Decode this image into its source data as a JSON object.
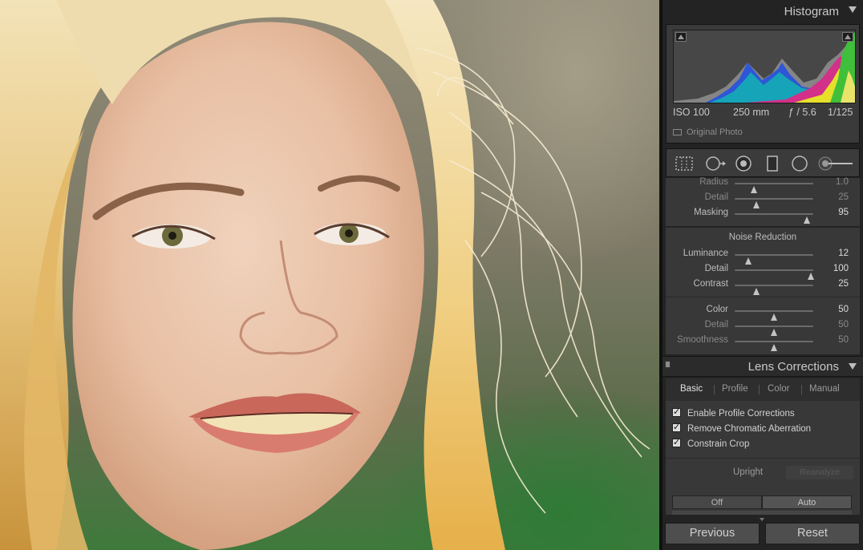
{
  "histogram": {
    "title": "Histogram",
    "iso": "ISO 100",
    "focal": "250 mm",
    "aperture": "ƒ / 5.6",
    "shutter": "1/125",
    "original_photo_label": "Original Photo"
  },
  "detail": {
    "rows": [
      {
        "label": "Radius",
        "value": "1.0",
        "level": 0.24,
        "dim": true
      },
      {
        "label": "Detail",
        "value": "25",
        "level": 0.28,
        "dim": true
      },
      {
        "label": "Masking",
        "value": "95",
        "level": 0.92,
        "dim": false
      }
    ]
  },
  "noise_reduction": {
    "title": "Noise Reduction",
    "luminance_rows": [
      {
        "label": "Luminance",
        "value": "12",
        "level": 0.17,
        "dim": false
      },
      {
        "label": "Detail",
        "value": "100",
        "level": 0.97,
        "dim": false
      },
      {
        "label": "Contrast",
        "value": "25",
        "level": 0.28,
        "dim": false
      }
    ],
    "color_rows": [
      {
        "label": "Color",
        "value": "50",
        "level": 0.5,
        "dim": false
      },
      {
        "label": "Detail",
        "value": "50",
        "level": 0.5,
        "dim": true
      },
      {
        "label": "Smoothness",
        "value": "50",
        "level": 0.5,
        "dim": true
      }
    ]
  },
  "lens_corrections": {
    "title": "Lens Corrections",
    "tabs": [
      "Basic",
      "Profile",
      "Color",
      "Manual"
    ],
    "active_tab": "Basic",
    "checkboxes": [
      "Enable Profile Corrections",
      "Remove Chromatic Aberration",
      "Constrain Crop"
    ],
    "upright_label": "Upright",
    "reanalyze_label": "Reanalyze",
    "upright_off": "Off",
    "upright_auto": "Auto"
  },
  "buttons": {
    "previous": "Previous",
    "reset": "Reset"
  }
}
